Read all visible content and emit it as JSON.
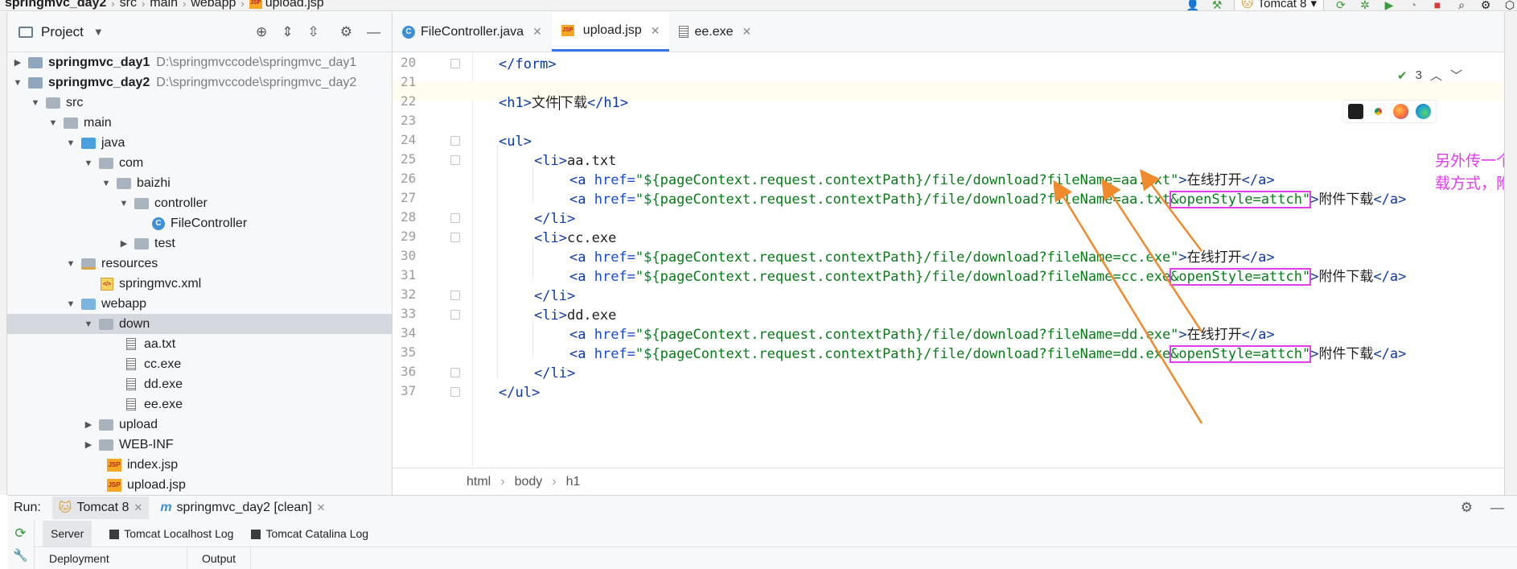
{
  "navbar": {
    "breadcrumbs": [
      "springmvc_day2",
      "src",
      "main",
      "webapp",
      "upload.jsp"
    ],
    "run_config": "Tomcat 8"
  },
  "project_panel": {
    "title": "Project",
    "tree": [
      {
        "label": "springmvc_day1",
        "path": "D:\\springmvccode\\springmvc_day1"
      },
      {
        "label": "springmvc_day2",
        "path": "D:\\springmvccode\\springmvc_day2"
      },
      {
        "label": "src"
      },
      {
        "label": "main"
      },
      {
        "label": "java"
      },
      {
        "label": "com"
      },
      {
        "label": "baizhi"
      },
      {
        "label": "controller"
      },
      {
        "label": "FileController"
      },
      {
        "label": "test"
      },
      {
        "label": "resources"
      },
      {
        "label": "springmvc.xml"
      },
      {
        "label": "webapp"
      },
      {
        "label": "down"
      },
      {
        "label": "aa.txt"
      },
      {
        "label": "cc.exe"
      },
      {
        "label": "dd.exe"
      },
      {
        "label": "ee.exe"
      },
      {
        "label": "upload"
      },
      {
        "label": "WEB-INF"
      },
      {
        "label": "index.jsp"
      },
      {
        "label": "upload.jsp"
      }
    ]
  },
  "editor": {
    "tabs": [
      {
        "label": "FileController.java"
      },
      {
        "label": "upload.jsp"
      },
      {
        "label": "ee.exe"
      }
    ],
    "inspection_count": "3",
    "line_numbers": [
      "20",
      "21",
      "22",
      "23",
      "24",
      "25",
      "26",
      "27",
      "28",
      "29",
      "30",
      "31",
      "32",
      "33",
      "34",
      "35",
      "36",
      "37"
    ],
    "breadcrumb": [
      "html",
      "body",
      "h1"
    ],
    "code": {
      "l20": "</form>",
      "l22_open": "<h1>",
      "l22_text_a": "文件",
      "l22_text_b": "下载",
      "l22_close": "</h1>",
      "l24": "<ul>",
      "li_open": "<li>",
      "li_close": "</li>",
      "ul_close": "</ul>",
      "a_open": "<a ",
      "href_attr": "href=",
      "a_close": "</a>",
      "open_online": "在线打开",
      "attach_download": "附件下载",
      "items": [
        {
          "name": "aa.txt",
          "href_online": "\"${pageContext.request.contextPath}/file/download?fileName=aa.txt\"",
          "href_prefix": "\"${pageContext.request.contextPath}/file/download?fileName=aa.txt",
          "href_suffix": "&openStyle=attch\""
        },
        {
          "name": "cc.exe",
          "href_online": "\"${pageContext.request.contextPath}/file/download?fileName=cc.exe\"",
          "href_prefix": "\"${pageContext.request.contextPath}/file/download?fileName=cc.exe",
          "href_suffix": "&openStyle=attch\""
        },
        {
          "name": "dd.exe",
          "href_online": "\"${pageContext.request.contextPath}/file/download?fileName=dd.exe\"",
          "href_prefix": "\"${pageContext.request.contextPath}/file/download?fileName=dd.exe",
          "href_suffix": "&openStyle=attch\""
        }
      ]
    },
    "annotation": "另外传一个参数，以便于让后台区分出是在线打开方式还是附件下载方式，附件下载方式有一个额外的参数"
  },
  "run_panel": {
    "label": "Run:",
    "tabs": [
      {
        "label": "Tomcat 8"
      },
      {
        "label": "springmvc_day2 [clean]"
      }
    ],
    "sub_tabs": [
      "Server",
      "Tomcat Localhost Log",
      "Tomcat Catalina Log"
    ],
    "columns": [
      "Deployment",
      "Output"
    ]
  },
  "colors": {
    "annotation": "#e23cf0",
    "arrow": "#f08a2c",
    "tag": "#0b3aa5",
    "string": "#067d17",
    "selection": "#d5d9df"
  }
}
